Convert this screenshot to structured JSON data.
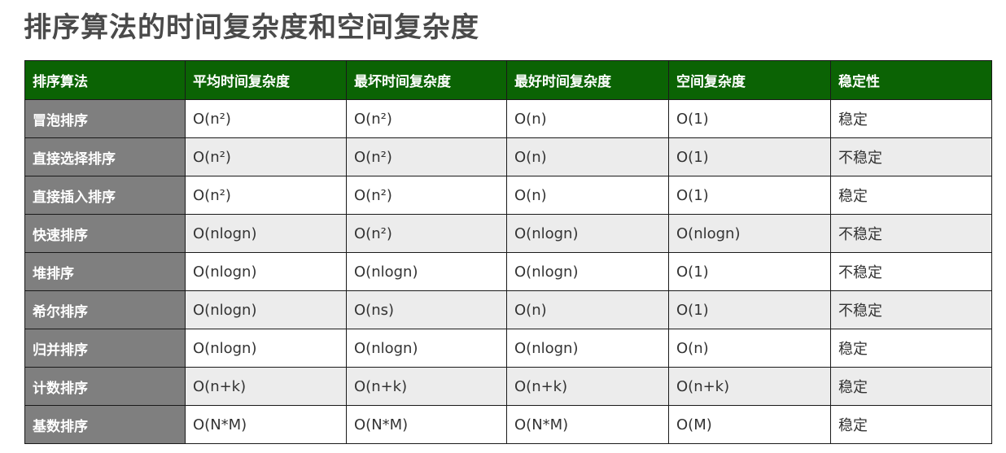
{
  "title": "排序算法的时间复杂度和空间复杂度",
  "table": {
    "headers": [
      "排序算法",
      "平均时间复杂度",
      "最坏时间复杂度",
      "最好时间复杂度",
      "空间复杂度",
      "稳定性"
    ],
    "rows": [
      [
        "冒泡排序",
        "O(n²)",
        "O(n²)",
        "O(n)",
        "O(1)",
        "稳定"
      ],
      [
        "直接选择排序",
        "O(n²)",
        "O(n²)",
        "O(n)",
        "O(1)",
        "不稳定"
      ],
      [
        "直接插入排序",
        "O(n²)",
        "O(n²)",
        "O(n)",
        "O(1)",
        "稳定"
      ],
      [
        "快速排序",
        "O(nlogn)",
        "O(n²)",
        "O(nlogn)",
        "O(nlogn)",
        "不稳定"
      ],
      [
        "堆排序",
        "O(nlogn)",
        "O(nlogn)",
        "O(nlogn)",
        "O(1)",
        "不稳定"
      ],
      [
        "希尔排序",
        "O(nlogn)",
        "O(ns)",
        "O(n)",
        "O(1)",
        "不稳定"
      ],
      [
        "归并排序",
        "O(nlogn)",
        "O(nlogn)",
        "O(nlogn)",
        "O(n)",
        "稳定"
      ],
      [
        "计数排序",
        "O(n+k)",
        "O(n+k)",
        "O(n+k)",
        "O(n+k)",
        "稳定"
      ],
      [
        "基数排序",
        "O(N*M)",
        "O(N*M)",
        "O(N*M)",
        "O(M)",
        "稳定"
      ]
    ]
  },
  "colors": {
    "header_bg": "#0b6304",
    "name_col_bg": "#7f7f7f",
    "stripe_bg": "#ececec",
    "title_color": "#4a4a4a"
  }
}
